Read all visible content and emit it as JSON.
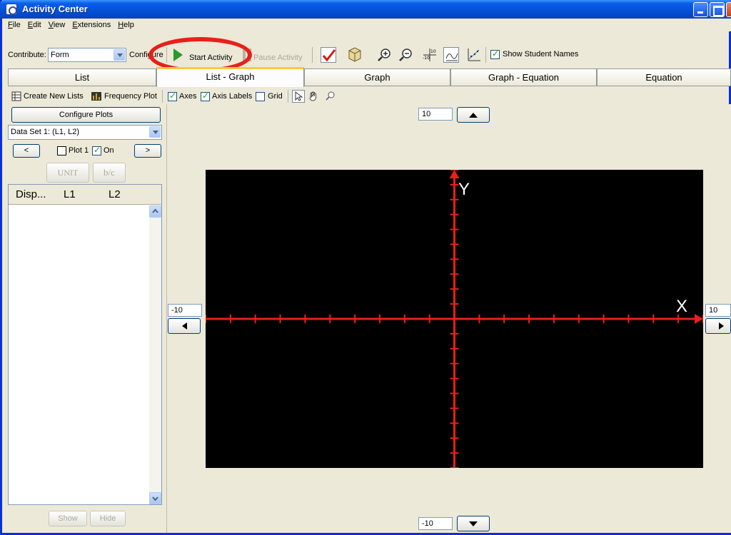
{
  "window": {
    "title": "Activity Center"
  },
  "menu": [
    "File",
    "Edit",
    "View",
    "Extensions",
    "Help"
  ],
  "toolbar": {
    "contribute_label": "Contribute:",
    "contribute_value": "Form",
    "configure_label": "Configure",
    "start_label": "Start Activity",
    "pause_label": "Pause Activity",
    "show_names_label": "Show Student Names",
    "show_names_checked": true
  },
  "tabs": [
    {
      "label": "List",
      "active": false
    },
    {
      "label": "List - Graph",
      "active": true
    },
    {
      "label": "Graph",
      "active": false
    },
    {
      "label": "Graph - Equation",
      "active": false
    },
    {
      "label": "Equation",
      "active": false
    }
  ],
  "subbar": {
    "create_lists": "Create New Lists",
    "frequency_plot": "Frequency Plot",
    "axes": "Axes",
    "axis_labels": "Axis Labels",
    "grid": "Grid"
  },
  "left": {
    "configure_plots": "Configure Plots",
    "dataset": "Data Set 1: (L1, L2)",
    "prev": "<",
    "next": ">",
    "plot_label": "Plot 1",
    "on_label": "On",
    "unit": "UNIT",
    "fraction": "b/c",
    "columns": [
      "Disp...",
      "L1",
      "L2"
    ],
    "show": "Show",
    "hide": "Hide"
  },
  "graph": {
    "ymax": "10",
    "ymin": "-10",
    "xmin": "-10",
    "xmax": "10",
    "x_label": "X",
    "y_label": "Y",
    "axis_color": "#e8201a"
  }
}
